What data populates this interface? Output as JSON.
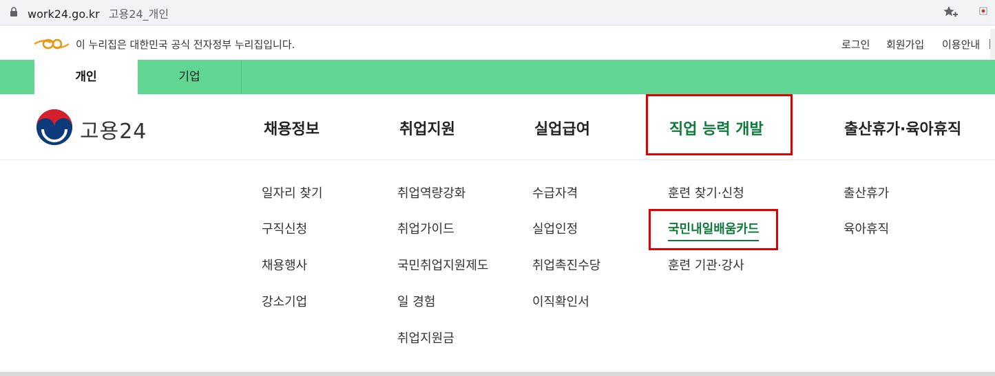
{
  "browser": {
    "url": "work24.go.kr",
    "tab_title": "고용24_개인"
  },
  "gov_banner": {
    "notice": "이 누리집은 대한민국 공식 전자정부 누리집입니다.",
    "links": [
      "로그인",
      "회원가입",
      "이용안내"
    ]
  },
  "tabs": [
    {
      "label": "개인",
      "selected": true
    },
    {
      "label": "기업",
      "selected": false
    }
  ],
  "logo": {
    "text": "고용24"
  },
  "nav": [
    {
      "label": "채용정보",
      "subs": [
        "일자리 찾기",
        "구직신청",
        "채용행사",
        "강소기업"
      ]
    },
    {
      "label": "취업지원",
      "subs": [
        "취업역량강화",
        "취업가이드",
        "국민취업지원제도",
        "일 경험",
        "취업지원금"
      ]
    },
    {
      "label": "실업급여",
      "subs": [
        "수급자격",
        "실업인정",
        "취업촉진수당",
        "이직확인서"
      ]
    },
    {
      "label": "직업 능력 개발",
      "subs": [
        "훈련 찾기·신청",
        "국민내일배움카드",
        "훈련 기관·강사"
      ]
    },
    {
      "label": "출산휴가·육아휴직",
      "subs": [
        "출산휴가",
        "육아휴직"
      ]
    }
  ],
  "colors": {
    "brand_green": "#61d592",
    "active_text": "#0d7a3a",
    "highlight_red": "#e00000"
  }
}
